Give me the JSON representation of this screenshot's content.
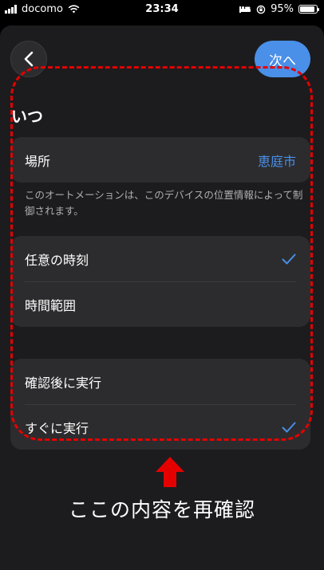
{
  "status_bar": {
    "carrier": "docomo",
    "time": "23:34",
    "battery_percent": "95%",
    "battery_level": 0.95
  },
  "header": {
    "back_icon": "chevron-left-icon",
    "next_label": "次へ"
  },
  "section": {
    "title": "いつ"
  },
  "location": {
    "label": "場所",
    "value": "恵庭市",
    "note": "このオートメーションは、このデバイスの位置情報によって制御されます。"
  },
  "time_options": [
    {
      "label": "任意の時刻",
      "selected": true
    },
    {
      "label": "時間範囲",
      "selected": false
    }
  ],
  "run_options": [
    {
      "label": "確認後に実行",
      "selected": false
    },
    {
      "label": "すぐに実行",
      "selected": true
    }
  ],
  "annotation": {
    "caption": "ここの内容を再確認",
    "color": "#e50000"
  },
  "colors": {
    "accent": "#4a8fe8",
    "background": "#1c1c1e",
    "card": "#2c2c2e"
  }
}
